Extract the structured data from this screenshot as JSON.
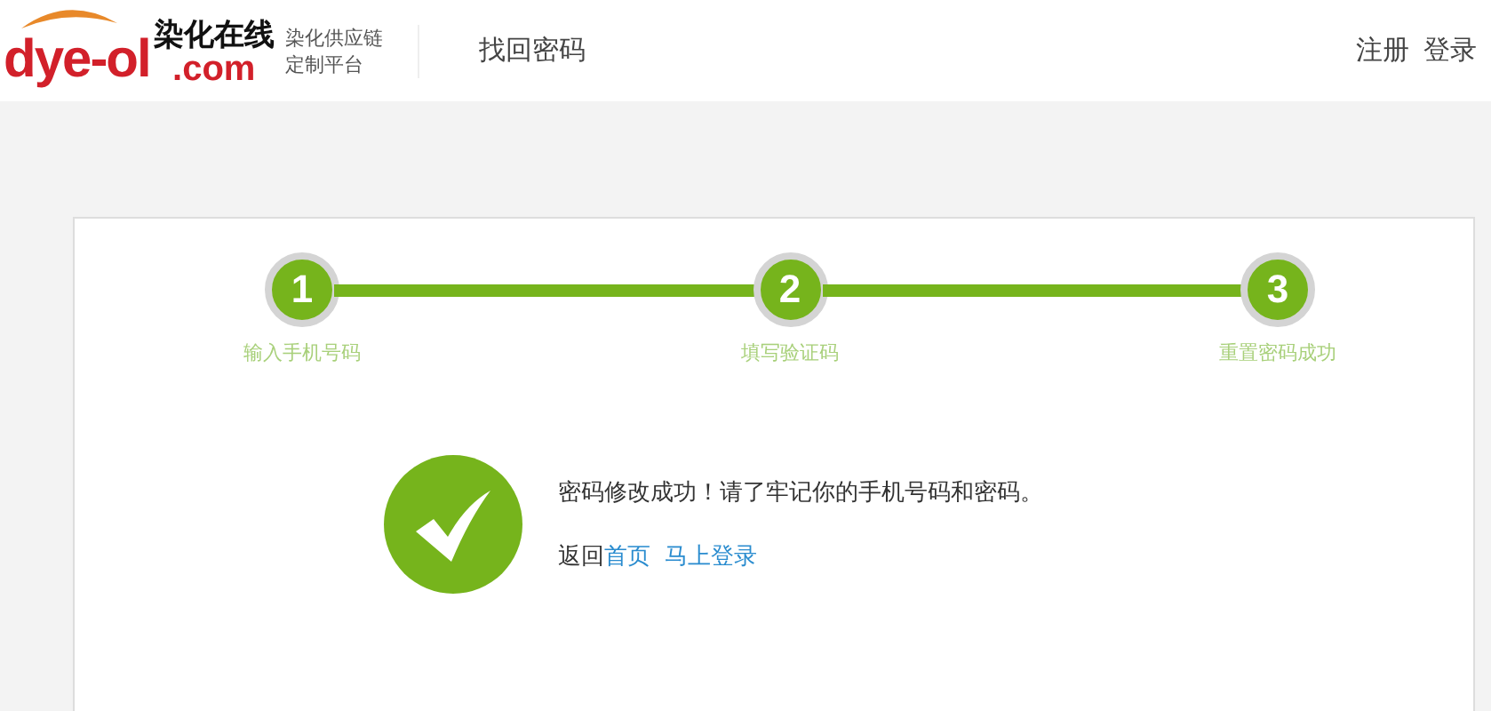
{
  "header": {
    "logo": {
      "brand": "dye-ol",
      "name_cn": "染化在线",
      "domain": ".com",
      "tagline": [
        "染化供应链",
        "定制平台"
      ]
    },
    "title": "找回密码",
    "links": [
      "注册",
      "登录"
    ]
  },
  "steps": [
    {
      "number": "1",
      "label": "输入手机号码",
      "done": true
    },
    {
      "number": "2",
      "label": "填写验证码",
      "done": true
    },
    {
      "number": "3",
      "label": "重置密码成功",
      "done": true
    }
  ],
  "result": {
    "message": "密码修改成功！请了牢记你的手机号码和密码。",
    "back_prefix": "返回",
    "links": [
      "首页",
      "马上登录"
    ]
  }
}
